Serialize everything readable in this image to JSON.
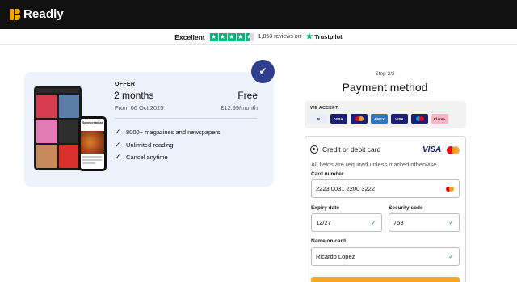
{
  "brand": {
    "name": "Readly",
    "logo_color": "#f7a600"
  },
  "trust": {
    "rating_word": "Excellent",
    "stars": 4.5,
    "reviews": "1,853 reviews on",
    "provider": "Trustpilot",
    "star_color": "#00b67a"
  },
  "offer": {
    "label": "OFFER",
    "duration": "2 months",
    "price": "Free",
    "from": "From 06 Oct 2025",
    "then_price": "£12.99/month",
    "badge_icon": "check-icon",
    "features": [
      "8000+ magazines and newspapers",
      "Unlimited reading",
      "Cancel anytime"
    ]
  },
  "payment": {
    "step": "Step 2/2",
    "title": "Payment method",
    "accept_label": "WE ACCEPT:",
    "methods": [
      {
        "name": "PayPal",
        "text": "P",
        "bg": "#e9eef8",
        "fg": "#003087"
      },
      {
        "name": "Visa",
        "text": "VISA",
        "bg": "#1a1f71",
        "fg": "#ffffff"
      },
      {
        "name": "Mastercard",
        "text": "",
        "bg": "#1a1f71",
        "fg": "#ffffff"
      },
      {
        "name": "American Express",
        "text": "AMEX",
        "bg": "#2e77bc",
        "fg": "#ffffff"
      },
      {
        "name": "Visa",
        "text": "VISA",
        "bg": "#1a1f71",
        "fg": "#ffffff"
      },
      {
        "name": "Maestro",
        "text": "",
        "bg": "#1a1f71",
        "fg": "#ffffff"
      },
      {
        "name": "Klarna",
        "text": "Klarna.",
        "bg": "#ffb3c7",
        "fg": "#17120f"
      }
    ],
    "selected_method": "Credit or debit card",
    "card_brand": "VISA",
    "required_note": "All fields are required unless marked otherwise.",
    "fields": {
      "card_number": {
        "label": "Card number",
        "value": "2223 0031 2200 3222"
      },
      "expiry": {
        "label": "Expiry date",
        "value": "12/27"
      },
      "security": {
        "label": "Security code",
        "value": "758"
      },
      "name": {
        "label": "Name on card",
        "value": "Ricardo Lopez"
      }
    },
    "accent": "#2f3e8f",
    "cta_color": "#f5a623"
  }
}
